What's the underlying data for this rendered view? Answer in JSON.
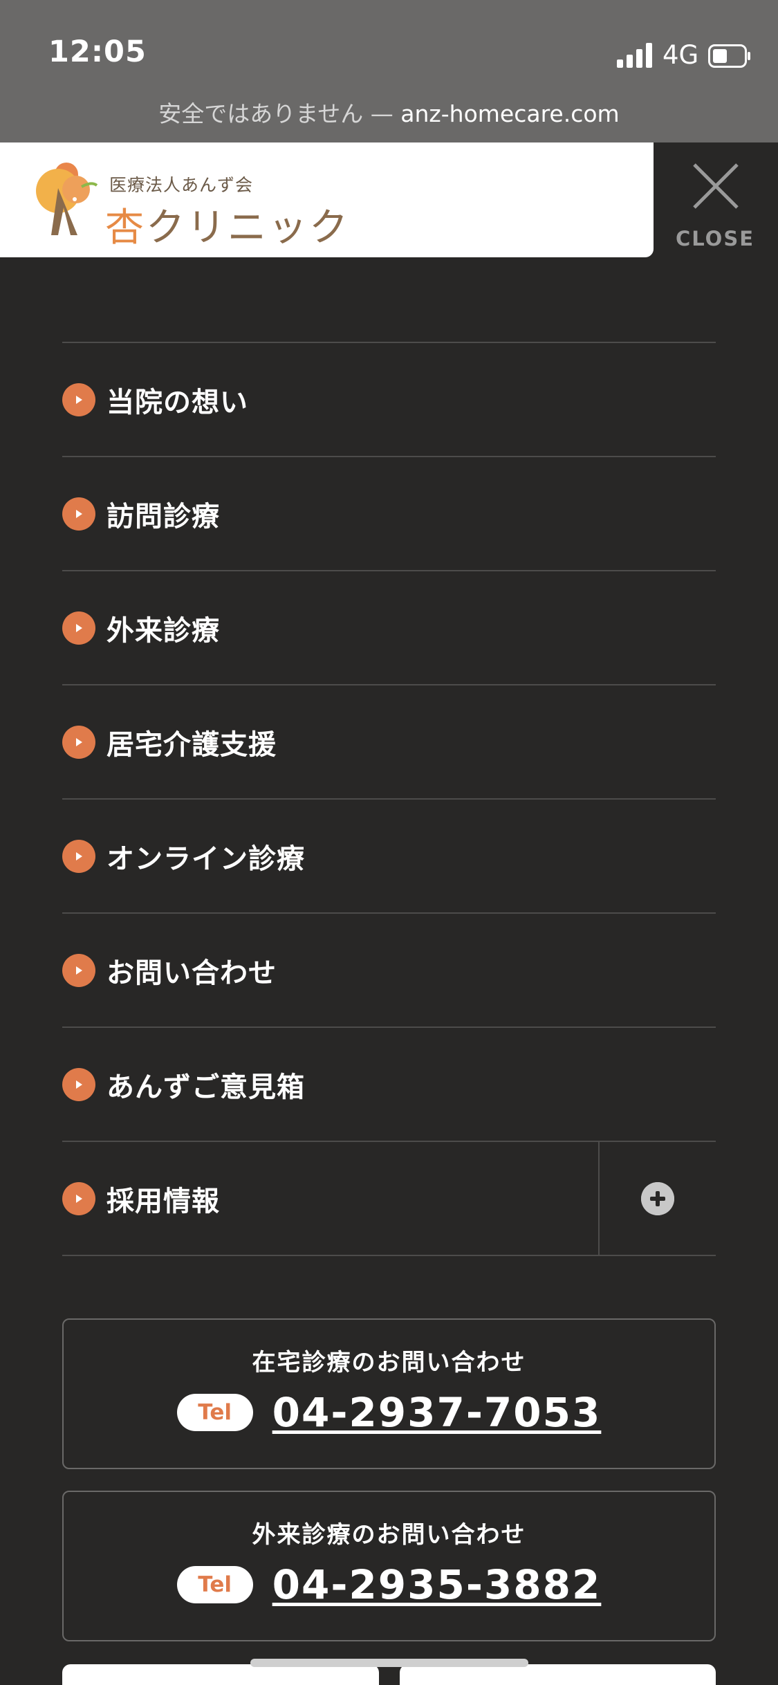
{
  "status_bar": {
    "time": "12:05",
    "network": "4G",
    "url_prefix": "安全ではありません — ",
    "url_host": "anz-homecare.com"
  },
  "header": {
    "logo_subtitle": "医療法人あんず会",
    "logo_title_accent": "杏",
    "logo_title_rest": "クリニック",
    "close_label": "CLOSE"
  },
  "menu": {
    "items": [
      {
        "label": "当院の想い"
      },
      {
        "label": "訪問診療"
      },
      {
        "label": "外来診療"
      },
      {
        "label": "居宅介護支援"
      },
      {
        "label": "オンライン診療"
      },
      {
        "label": "お問い合わせ"
      },
      {
        "label": "あんずご意見箱"
      },
      {
        "label": "採用情報"
      }
    ]
  },
  "contacts": [
    {
      "title": "在宅診療のお問い合わせ",
      "badge": "Tel",
      "number": "04-2937-7053"
    },
    {
      "title": "外来診療のお問い合わせ",
      "badge": "Tel",
      "number": "04-2935-3882"
    }
  ],
  "colors": {
    "background": "#282726",
    "accent": "#e07b4b",
    "status_bar": "#6a6968"
  }
}
